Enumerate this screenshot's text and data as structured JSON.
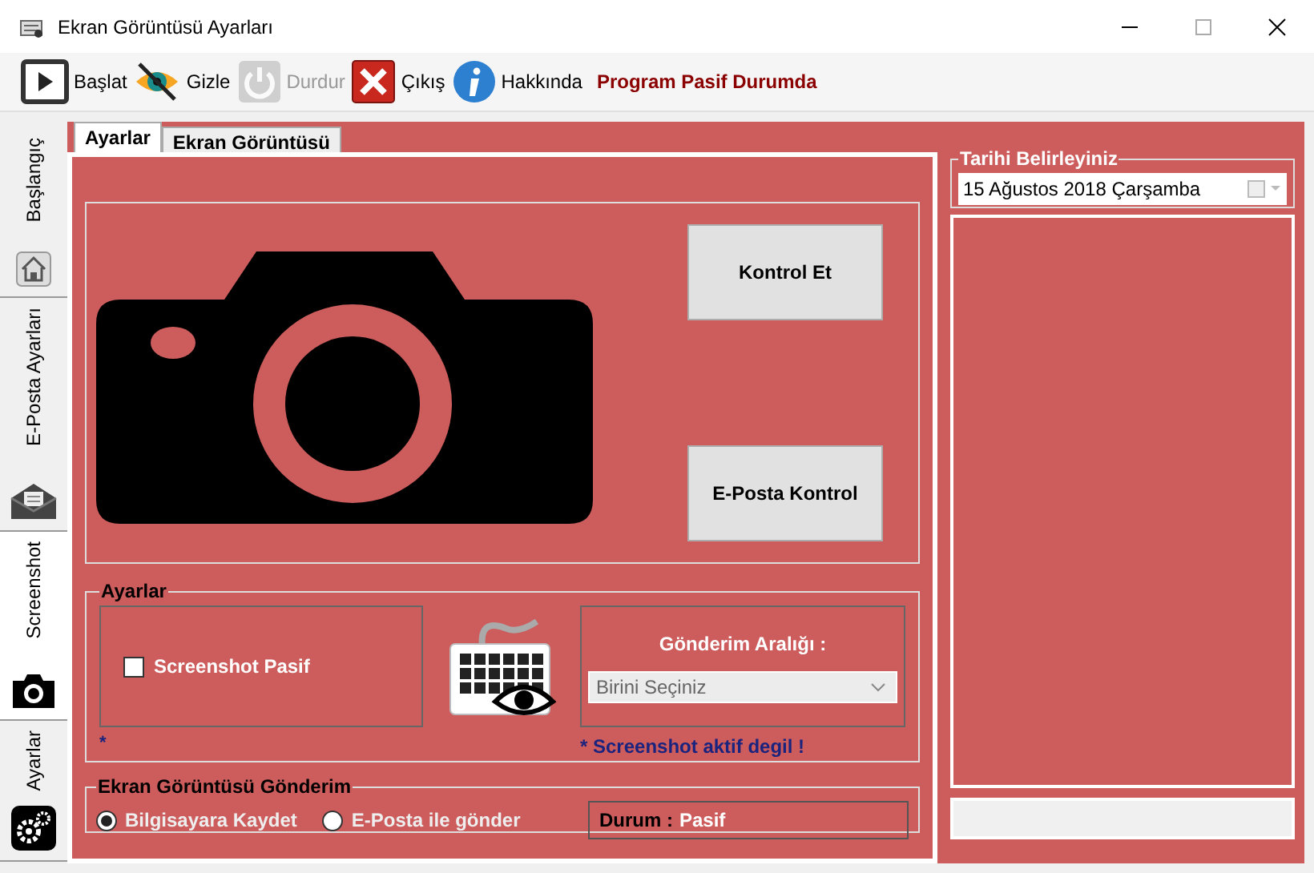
{
  "window": {
    "title": "Ekran Görüntüsü Ayarları"
  },
  "toolbar": [
    {
      "kind": "play",
      "label": "Başlat",
      "disabled": false
    },
    {
      "kind": "hide",
      "label": "Gizle",
      "disabled": false
    },
    {
      "kind": "power",
      "label": "Durdur",
      "disabled": true
    },
    {
      "kind": "exit",
      "label": "Çıkış",
      "disabled": false
    },
    {
      "kind": "info",
      "label": "Hakkında",
      "disabled": false
    }
  ],
  "status_text": "Program Pasif Durumda",
  "side_tabs": [
    {
      "kind": "home",
      "label": "Başlangıç",
      "selected": false
    },
    {
      "kind": "mail",
      "label": "E-Posta Ayarları",
      "selected": false
    },
    {
      "kind": "camera",
      "label": "Screenshot",
      "selected": true
    },
    {
      "kind": "gears",
      "label": "Ayarlar",
      "selected": false
    }
  ],
  "tabs": [
    {
      "label": "Ayarlar",
      "selected": true
    },
    {
      "label": "Ekran Görüntüsü",
      "selected": false
    }
  ],
  "buttons": [
    "Kontrol Et",
    "E-Posta Kontrol"
  ],
  "settings": {
    "title": "Ayarlar",
    "checkbox": {
      "label": "Screenshot Pasif",
      "checked": false
    },
    "left_note": "*",
    "interval_label": "Gönderim Aralığı :",
    "interval_placeholder": "Birini Seçiniz",
    "warning": "* Screenshot aktif degil !"
  },
  "sending": {
    "title": "Ekran Görüntüsü Gönderim",
    "options": [
      {
        "label": "Bilgisayara Kaydet",
        "selected": true
      },
      {
        "label": "E-Posta ile gönder",
        "selected": false
      }
    ],
    "status_label": "Durum :",
    "status_value": "Pasif"
  },
  "date": {
    "title": "Tarihi Belirleyiniz",
    "value": "15 Ağustos 2018 Çarşamba"
  }
}
